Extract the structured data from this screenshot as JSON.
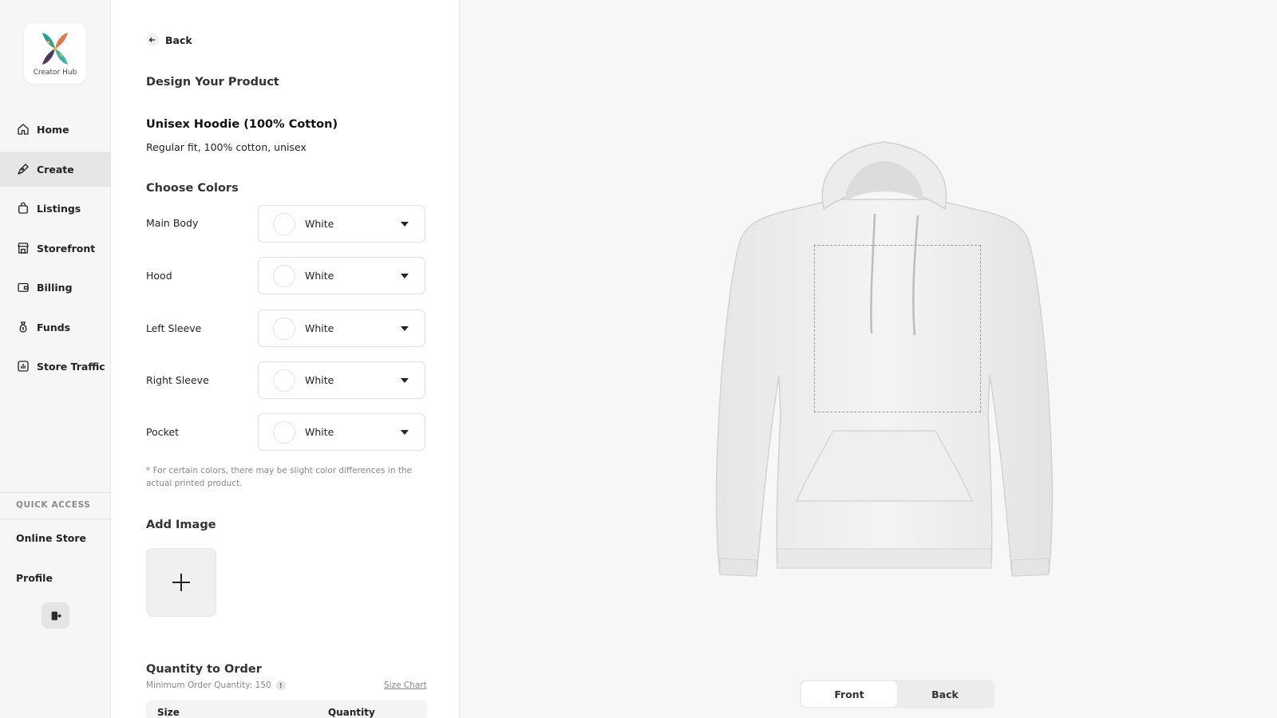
{
  "brand": {
    "name": "Creator Hub"
  },
  "sidebar": {
    "items": [
      {
        "label": "Home",
        "icon": "home-icon"
      },
      {
        "label": "Create",
        "icon": "pen-tool-icon",
        "active": true
      },
      {
        "label": "Listings",
        "icon": "shopping-bag-icon"
      },
      {
        "label": "Storefront",
        "icon": "storefront-icon"
      },
      {
        "label": "Billing",
        "icon": "wallet-icon"
      },
      {
        "label": "Funds",
        "icon": "money-bag-icon"
      },
      {
        "label": "Store Traffic",
        "icon": "bar-chart-icon"
      }
    ],
    "quick_access": {
      "title": "QUICK ACCESS",
      "items": [
        {
          "label": "Online Store"
        },
        {
          "label": "Profile"
        }
      ]
    },
    "logout_icon": "logout-icon"
  },
  "panel": {
    "back_label": "Back",
    "design_title": "Design Your Product",
    "product": {
      "name": "Unisex Hoodie (100% Cotton)",
      "description": "Regular fit, 100% cotton, unisex"
    },
    "colors": {
      "title": "Choose Colors",
      "rows": [
        {
          "label": "Main Body",
          "value": "White",
          "swatch": "#ffffff"
        },
        {
          "label": "Hood",
          "value": "White",
          "swatch": "#ffffff"
        },
        {
          "label": "Left Sleeve",
          "value": "White",
          "swatch": "#ffffff"
        },
        {
          "label": "Right Sleeve",
          "value": "White",
          "swatch": "#ffffff"
        },
        {
          "label": "Pocket",
          "value": "White",
          "swatch": "#ffffff"
        }
      ],
      "note": "* For certain colors, there may be slight color differences in the actual printed product."
    },
    "add_image": {
      "title": "Add Image"
    },
    "quantity": {
      "title": "Quantity to Order",
      "min_label": "Minimum Order Quantity: 150",
      "size_chart_label": "Size Chart",
      "columns": [
        "Size",
        "Quantity"
      ]
    }
  },
  "preview": {
    "views": [
      {
        "label": "Front",
        "active": true
      },
      {
        "label": "Back",
        "active": false
      }
    ]
  }
}
